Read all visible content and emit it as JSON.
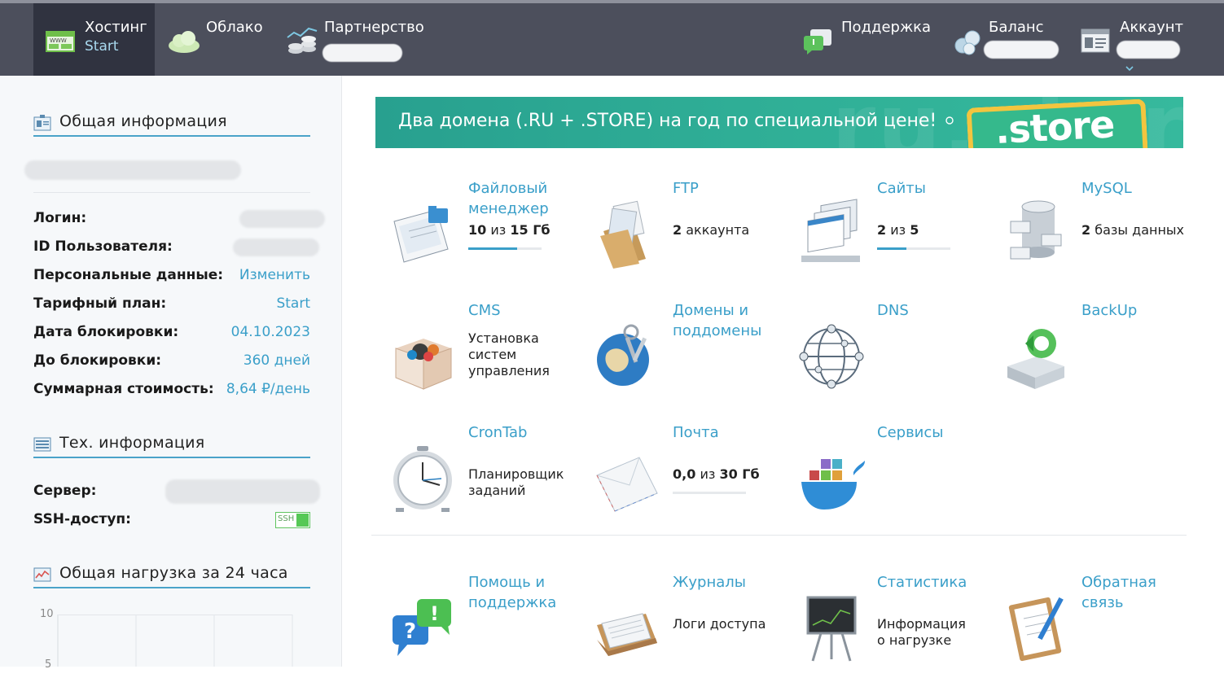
{
  "nav": {
    "hosting": {
      "title": "Хостинг",
      "sub": "Start"
    },
    "cloud": {
      "title": "Облако"
    },
    "partner": {
      "title": "Партнерство"
    },
    "support": {
      "title": "Поддержка"
    },
    "balance": {
      "title": "Баланс"
    },
    "account": {
      "title": "Аккаунт"
    }
  },
  "sidebar": {
    "general_title": "Общая информация",
    "rows": {
      "login": {
        "label": "Логин:"
      },
      "user_id": {
        "label": "ID Пользователя:"
      },
      "personal": {
        "label": "Персональные данные:",
        "value": "Изменить"
      },
      "tariff": {
        "label": "Тарифный план:",
        "value": "Start"
      },
      "block_date": {
        "label": "Дата блокировки:",
        "value": "04.10.2023"
      },
      "until_block": {
        "label": "До блокировки:",
        "value": "360 дней"
      },
      "total_cost": {
        "label": "Суммарная стоимость:",
        "value": "8,64 ₽/день"
      }
    },
    "tech_title": "Тех. информация",
    "server_label": "Сервер:",
    "ssh_label": "SSH-доступ:",
    "ssh_toggle_text": "SSH",
    "load_title": "Общая нагрузка за 24 часа",
    "load_ticks": [
      "10",
      "5"
    ]
  },
  "banner": {
    "text": "Два домена (.RU + .STORE) на год по специальной цене!",
    "store_logo": ".store"
  },
  "tiles": {
    "files": {
      "title": "Файловый менеджер",
      "info": {
        "a": "10",
        "mid": "из",
        "b": "15 Гб"
      },
      "fill": 0.67
    },
    "ftp": {
      "title": "FTP",
      "info": {
        "a": "2",
        "rest": "аккаунта"
      }
    },
    "sites": {
      "title": "Сайты",
      "info": {
        "a": "2",
        "mid": "из",
        "b": "5"
      },
      "fill": 0.4
    },
    "mysql": {
      "title": "MySQL",
      "info": {
        "a": "2",
        "rest": "базы данных"
      }
    },
    "cms": {
      "title": "CMS",
      "desc": [
        "Установка",
        "систем",
        "управления"
      ]
    },
    "domains": {
      "title": "Домены и поддомены"
    },
    "dns": {
      "title": "DNS"
    },
    "backup": {
      "title": "BackUp"
    },
    "cron": {
      "title": "CronTab",
      "desc": [
        "Планировщик",
        "заданий"
      ]
    },
    "mail": {
      "title": "Почта",
      "info": {
        "a": "0,0",
        "mid": "из",
        "b": "30 Гб"
      },
      "fill": 0.0
    },
    "services": {
      "title": "Сервисы"
    },
    "help": {
      "title": "Помощь и поддержка"
    },
    "logs": {
      "title": "Журналы",
      "desc": [
        "Логи доступа"
      ]
    },
    "stats": {
      "title": "Статистика",
      "desc": [
        "Информация",
        "о нагрузке"
      ]
    },
    "feedback": {
      "title": "Обратная связь"
    }
  },
  "colors": {
    "accent": "#3a9fc9",
    "topbar": "#4c4f5c",
    "active_nav": "#303340",
    "banner": "#2fae96",
    "ssh_on": "#56c856"
  }
}
